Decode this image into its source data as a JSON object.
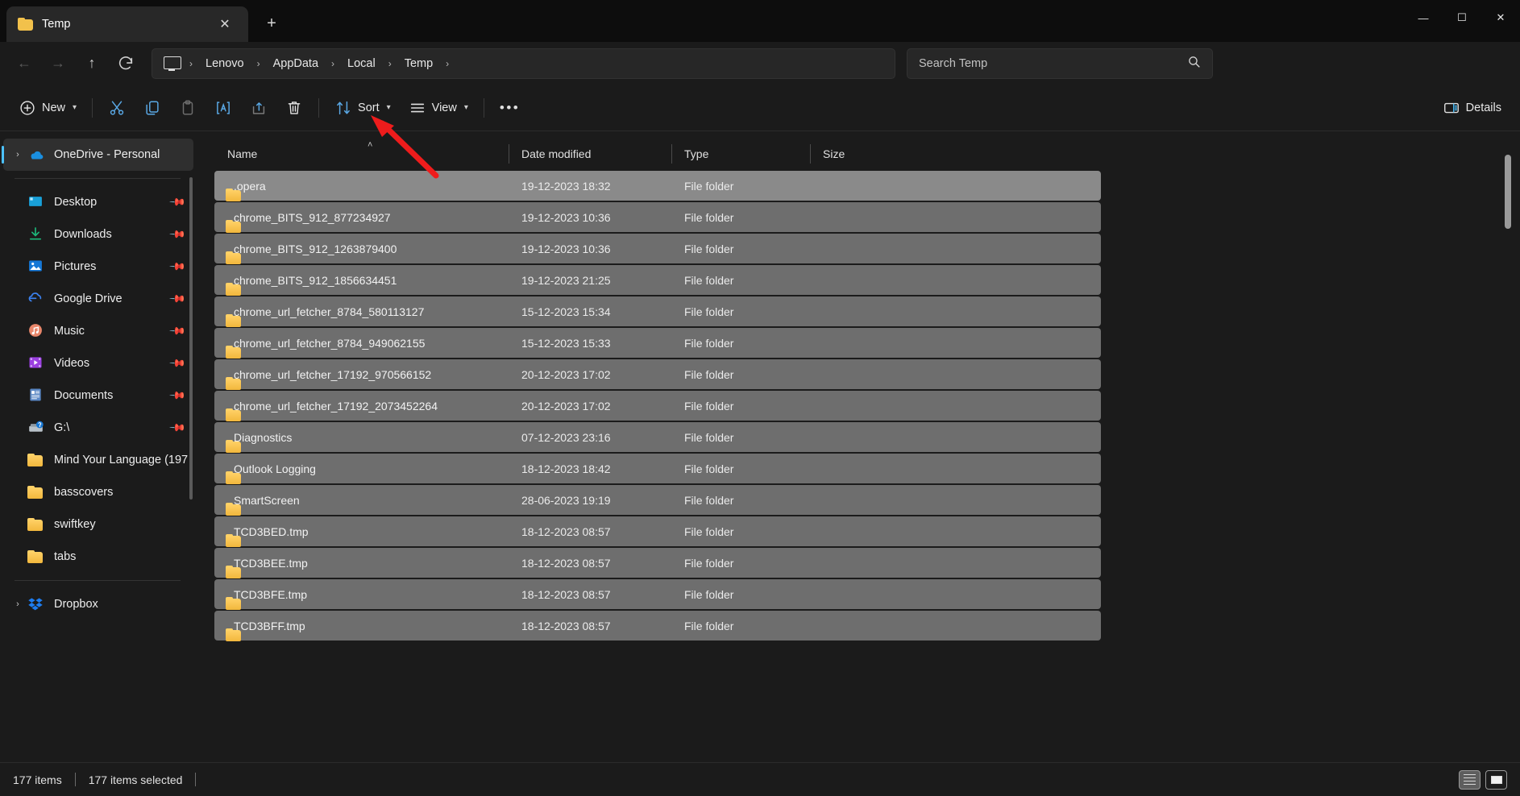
{
  "window": {
    "tab_title": "Temp",
    "tab_close_icon": "close-icon",
    "new_tab_icon": "plus-icon",
    "minimize_icon": "minimize-icon",
    "maximize_icon": "maximize-icon",
    "close_icon": "close-icon"
  },
  "nav": {
    "back_icon": "arrow-left-icon",
    "forward_icon": "arrow-right-icon",
    "up_icon": "arrow-up-icon",
    "refresh_icon": "refresh-icon",
    "breadcrumb_root_icon": "this-pc-icon",
    "breadcrumb": [
      "Lenovo",
      "AppData",
      "Local",
      "Temp"
    ],
    "breadcrumb_separator": "›"
  },
  "search": {
    "placeholder": "Search Temp",
    "value": "",
    "icon": "search-icon"
  },
  "toolbar": {
    "new_label": "New",
    "new_icon": "plus-circle-icon",
    "cut_icon": "scissors-icon",
    "copy_icon": "copy-icon",
    "paste_icon": "paste-icon",
    "rename_icon": "rename-icon",
    "share_icon": "share-icon",
    "delete_icon": "trash-icon",
    "sort_label": "Sort",
    "sort_icon": "sort-arrows-icon",
    "view_label": "View",
    "view_icon": "list-lines-icon",
    "more_label": "•••",
    "details_label": "Details",
    "details_icon": "details-pane-icon",
    "chevron": "⌄"
  },
  "sidebar": {
    "onedrive": {
      "label": "OneDrive - Personal",
      "icon": "onedrive-cloud-icon",
      "expand": "›",
      "selected": true
    },
    "items": [
      {
        "label": "Desktop",
        "icon": "desktop-icon",
        "pinned": true
      },
      {
        "label": "Downloads",
        "icon": "downloads-icon",
        "pinned": true
      },
      {
        "label": "Pictures",
        "icon": "pictures-icon",
        "pinned": true
      },
      {
        "label": "Google Drive",
        "icon": "googledrive-icon",
        "pinned": true
      },
      {
        "label": "Music",
        "icon": "music-icon",
        "pinned": true
      },
      {
        "label": "Videos",
        "icon": "videos-icon",
        "pinned": true
      },
      {
        "label": "Documents",
        "icon": "documents-icon",
        "pinned": true
      },
      {
        "label": "G:\\",
        "icon": "drive-icon",
        "pinned": true
      },
      {
        "label": "Mind Your Language (197",
        "icon": "folder-icon",
        "pinned": false
      },
      {
        "label": "basscovers",
        "icon": "folder-icon",
        "pinned": false
      },
      {
        "label": "swiftkey",
        "icon": "folder-icon",
        "pinned": false
      },
      {
        "label": "tabs",
        "icon": "folder-icon",
        "pinned": false
      }
    ],
    "dropbox": {
      "label": "Dropbox",
      "icon": "dropbox-icon",
      "expand": "›"
    }
  },
  "filelist": {
    "columns": [
      "Name",
      "Date modified",
      "Type",
      "Size"
    ],
    "sort_indicator": "˄",
    "rows": [
      {
        "name": ".opera",
        "date": "19-12-2023 18:32",
        "type": "File folder",
        "size": "",
        "active": true
      },
      {
        "name": "chrome_BITS_912_877234927",
        "date": "19-12-2023 10:36",
        "type": "File folder",
        "size": "",
        "active": false
      },
      {
        "name": "chrome_BITS_912_1263879400",
        "date": "19-12-2023 10:36",
        "type": "File folder",
        "size": "",
        "active": false
      },
      {
        "name": "chrome_BITS_912_1856634451",
        "date": "19-12-2023 21:25",
        "type": "File folder",
        "size": "",
        "active": false
      },
      {
        "name": "chrome_url_fetcher_8784_580113127",
        "date": "15-12-2023 15:34",
        "type": "File folder",
        "size": "",
        "active": false
      },
      {
        "name": "chrome_url_fetcher_8784_949062155",
        "date": "15-12-2023 15:33",
        "type": "File folder",
        "size": "",
        "active": false
      },
      {
        "name": "chrome_url_fetcher_17192_970566152",
        "date": "20-12-2023 17:02",
        "type": "File folder",
        "size": "",
        "active": false
      },
      {
        "name": "chrome_url_fetcher_17192_2073452264",
        "date": "20-12-2023 17:02",
        "type": "File folder",
        "size": "",
        "active": false
      },
      {
        "name": "Diagnostics",
        "date": "07-12-2023 23:16",
        "type": "File folder",
        "size": "",
        "active": false
      },
      {
        "name": "Outlook Logging",
        "date": "18-12-2023 18:42",
        "type": "File folder",
        "size": "",
        "active": false
      },
      {
        "name": "SmartScreen",
        "date": "28-06-2023 19:19",
        "type": "File folder",
        "size": "",
        "active": false
      },
      {
        "name": "TCD3BED.tmp",
        "date": "18-12-2023 08:57",
        "type": "File folder",
        "size": "",
        "active": false
      },
      {
        "name": "TCD3BEE.tmp",
        "date": "18-12-2023 08:57",
        "type": "File folder",
        "size": "",
        "active": false
      },
      {
        "name": "TCD3BFE.tmp",
        "date": "18-12-2023 08:57",
        "type": "File folder",
        "size": "",
        "active": false
      },
      {
        "name": "TCD3BFF.tmp",
        "date": "18-12-2023 08:57",
        "type": "File folder",
        "size": "",
        "active": false
      }
    ]
  },
  "status": {
    "item_count": "177 items",
    "selected_count": "177 items selected",
    "details_view_icon": "details-view-icon",
    "large_icons_view_icon": "large-icons-view-icon"
  },
  "annotation": {
    "arrow_color": "#ee1c1c",
    "points_to": "trash-icon"
  }
}
